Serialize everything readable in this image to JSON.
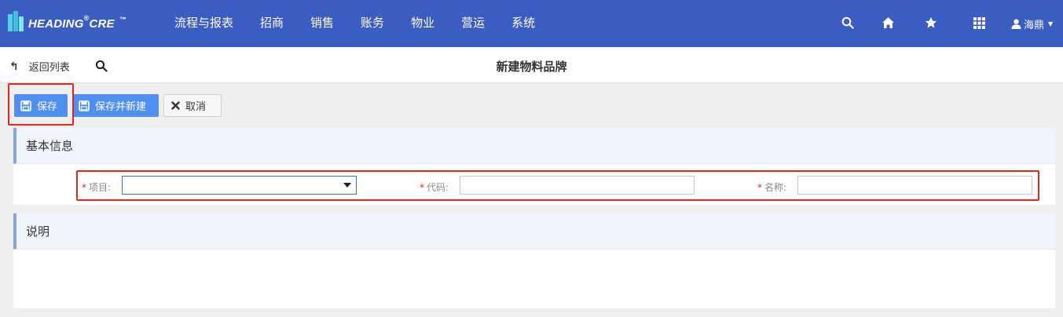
{
  "header": {
    "logo_text": "HEADING",
    "logo_reg": "®",
    "logo_suffix": "CRE",
    "logo_tm": "™",
    "nav": [
      "流程与报表",
      "招商",
      "销售",
      "账务",
      "物业",
      "营运",
      "系统"
    ],
    "user_name": "海鼎",
    "icons": [
      "search-icon",
      "home-icon",
      "star-icon",
      "apps-grid-icon",
      "user-icon",
      "caret-down-icon"
    ]
  },
  "subbar": {
    "back_label": "返回列表",
    "title": "新建物料品牌"
  },
  "toolbar": {
    "save_label": "保存",
    "save_new_label": "保存并新建",
    "cancel_label": "取消"
  },
  "basic_info": {
    "title": "基本信息",
    "fields": [
      {
        "required": "*",
        "label": "项目:",
        "value": "",
        "type": "select"
      },
      {
        "required": "*",
        "label": "代码:",
        "value": "",
        "type": "text"
      },
      {
        "required": "*",
        "label": "名称:",
        "value": "",
        "type": "text"
      }
    ]
  },
  "description": {
    "title": "说明"
  },
  "colors": {
    "topbar": "#3b5cc0",
    "primary_button": "#4e8ff0",
    "highlight": "#e8261d",
    "section_accent": "#7ea6e8"
  }
}
